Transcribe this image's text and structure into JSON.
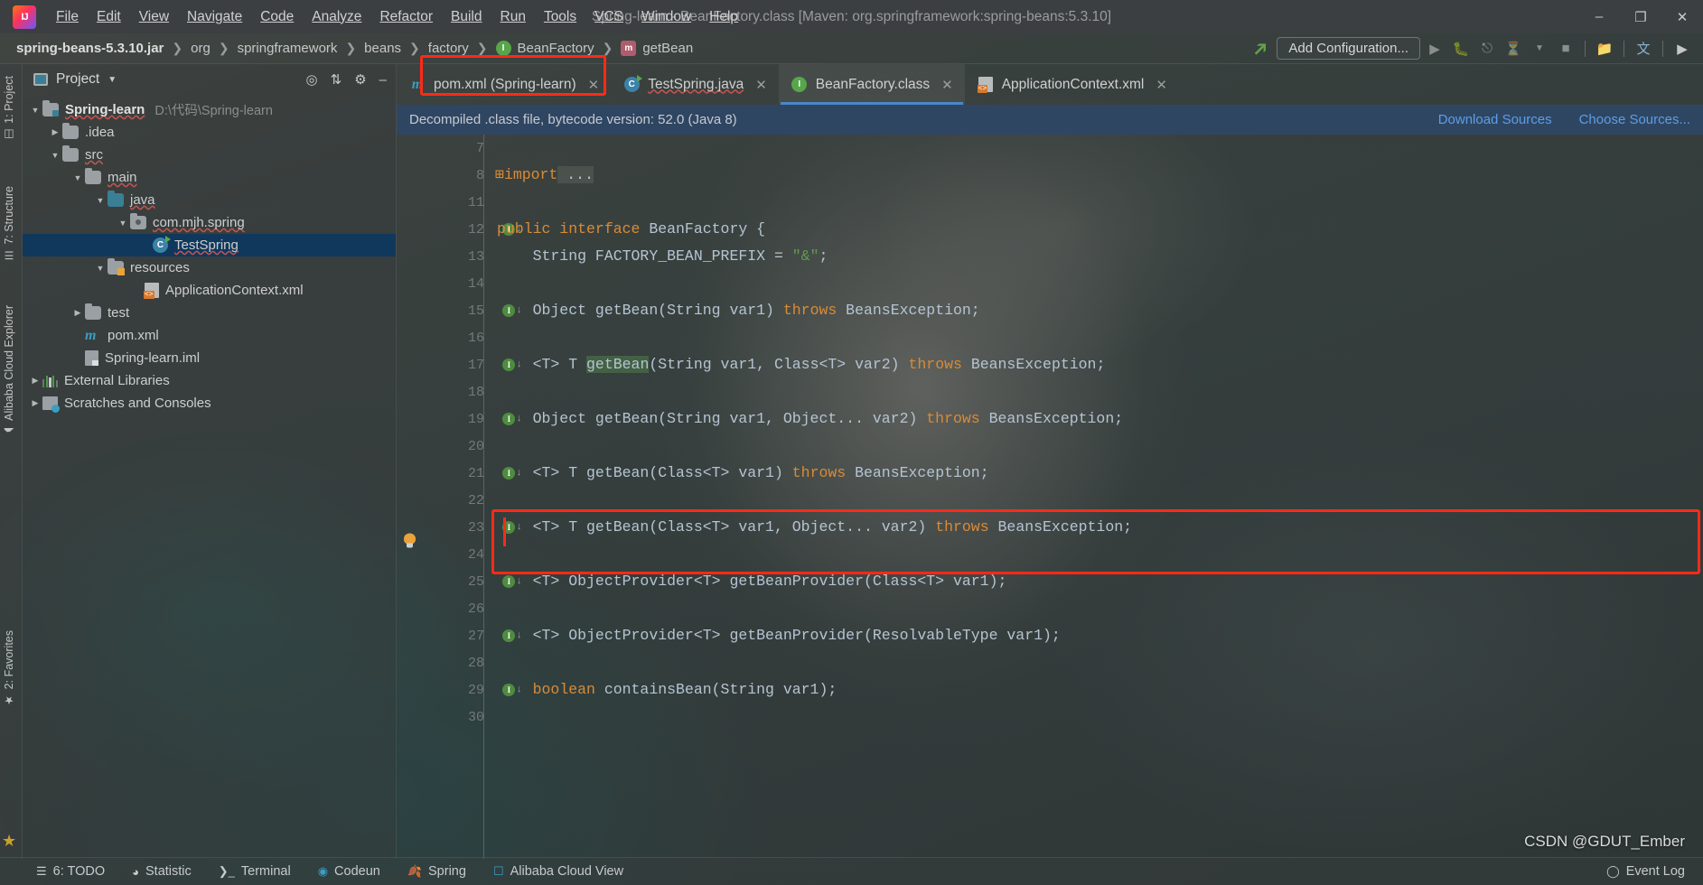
{
  "window": {
    "title": "Spring-learn - BeanFactory.class [Maven: org.springframework:spring-beans:5.3.10]",
    "logo": "intellij-idea-logo",
    "minimize": "–",
    "maximize": "❐",
    "close": "✕"
  },
  "menu": [
    {
      "label": "File"
    },
    {
      "label": "Edit"
    },
    {
      "label": "View"
    },
    {
      "label": "Navigate"
    },
    {
      "label": "Code"
    },
    {
      "label": "Analyze"
    },
    {
      "label": "Refactor"
    },
    {
      "label": "Build"
    },
    {
      "label": "Run"
    },
    {
      "label": "Tools"
    },
    {
      "label": "VCS"
    },
    {
      "label": "Window"
    },
    {
      "label": "Help"
    }
  ],
  "breadcrumb": [
    {
      "label": "spring-beans-5.3.10.jar",
      "icon": "",
      "bold": true
    },
    {
      "label": "org",
      "icon": ""
    },
    {
      "label": "springframework",
      "icon": ""
    },
    {
      "label": "beans",
      "icon": ""
    },
    {
      "label": "factory",
      "icon": ""
    },
    {
      "label": "BeanFactory",
      "icon": "interface-icon"
    },
    {
      "label": "getBean",
      "icon": "method-icon"
    }
  ],
  "toolbar": {
    "add_configuration": "Add Configuration...",
    "run_icon": "run-icon",
    "debug_icon": "debug-icon",
    "coverage_icon": "coverage-icon",
    "profile_icon": "profile-icon",
    "dropdown_icon": "chevron-down-icon",
    "stop_icon": "stop-icon",
    "project_structure_icon": "project-structure-icon",
    "translate_icon": "translate-icon",
    "console_icon": "console-icon"
  },
  "left_strip": [
    {
      "label": "1: Project",
      "icon": "project-icon"
    },
    {
      "label": "7: Structure",
      "icon": "structure-icon"
    },
    {
      "label": "Alibaba Cloud Explorer",
      "icon": "cloud-icon"
    },
    {
      "label": "2: Favorites",
      "icon": "star-icon"
    }
  ],
  "project_panel": {
    "title": "Project",
    "caret": "▼",
    "locate_icon": "locate-target-icon",
    "collapse_icon": "collapse-all-icon",
    "settings_icon": "gear-icon",
    "hide_icon": "hide-icon",
    "tree": [
      {
        "label": "Spring-learn",
        "path": "D:\\代码\\Spring-learn",
        "indent": 0,
        "arrow": "▼",
        "icon": "module-folder-icon",
        "bold": true,
        "selected": false
      },
      {
        "label": ".idea",
        "path": "",
        "indent": 1,
        "arrow": "▶",
        "icon": "folder-icon",
        "bold": false,
        "selected": false
      },
      {
        "label": "src",
        "path": "",
        "indent": 1,
        "arrow": "▼",
        "icon": "folder-icon",
        "bold": false,
        "selected": false
      },
      {
        "label": "main",
        "path": "",
        "indent": 2,
        "arrow": "▼",
        "icon": "folder-icon",
        "bold": false,
        "selected": false
      },
      {
        "label": "java",
        "path": "",
        "indent": 3,
        "arrow": "▼",
        "icon": "source-folder-icon",
        "bold": false,
        "selected": false
      },
      {
        "label": "com.mjh.spring",
        "path": "",
        "indent": 4,
        "arrow": "▼",
        "icon": "package-icon",
        "bold": false,
        "selected": false
      },
      {
        "label": "TestSpring",
        "path": "",
        "indent": 5,
        "arrow": "",
        "icon": "java-class-icon",
        "bold": false,
        "selected": true
      },
      {
        "label": "resources",
        "path": "",
        "indent": 3,
        "arrow": "▼",
        "icon": "resources-folder-icon",
        "bold": false,
        "selected": false
      },
      {
        "label": "ApplicationContext.xml",
        "path": "",
        "indent": 4,
        "arrow": "",
        "icon": "xml-file-icon",
        "bold": false,
        "selected": false
      },
      {
        "label": "test",
        "path": "",
        "indent": 2,
        "arrow": "▶",
        "icon": "folder-icon",
        "bold": false,
        "selected": false
      },
      {
        "label": "pom.xml",
        "path": "",
        "indent": 2,
        "arrow": "",
        "icon": "maven-icon",
        "bold": false,
        "selected": false
      },
      {
        "label": "Spring-learn.iml",
        "path": "",
        "indent": 2,
        "arrow": "",
        "icon": "iml-file-icon",
        "bold": false,
        "selected": false
      },
      {
        "label": "External Libraries",
        "path": "",
        "indent": 0,
        "arrow": "▶",
        "icon": "libraries-icon",
        "bold": false,
        "selected": false
      },
      {
        "label": "Scratches and Consoles",
        "path": "",
        "indent": 0,
        "arrow": "▶",
        "icon": "scratches-icon",
        "bold": false,
        "selected": false
      }
    ]
  },
  "editor": {
    "tabs": [
      {
        "label": "pom.xml (Spring-learn)",
        "icon": "maven-icon",
        "active": false,
        "close": "✕"
      },
      {
        "label": "TestSpring.java",
        "icon": "java-class-icon",
        "active": false,
        "close": "✕"
      },
      {
        "label": "BeanFactory.class",
        "icon": "interface-icon",
        "active": true,
        "close": "✕"
      },
      {
        "label": "ApplicationContext.xml",
        "icon": "xml-file-icon",
        "active": false,
        "close": "✕"
      }
    ],
    "notification": {
      "message": "Decompiled .class file, bytecode version: 52.0 (Java 8)",
      "download_sources": "Download Sources",
      "choose_sources": "Choose Sources..."
    },
    "lines": [
      {
        "num": "7",
        "text": "",
        "marker": false,
        "bulb": false,
        "fold": false
      },
      {
        "num": "8",
        "text": "import ...",
        "marker": false,
        "bulb": false,
        "fold": true
      },
      {
        "num": "11",
        "text": "",
        "marker": false,
        "bulb": false,
        "fold": false
      },
      {
        "num": "12",
        "text": "public interface BeanFactory {",
        "marker": true,
        "bulb": false,
        "fold": false
      },
      {
        "num": "13",
        "text": "    String FACTORY_BEAN_PREFIX = \"&\";",
        "marker": false,
        "bulb": false,
        "fold": false
      },
      {
        "num": "14",
        "text": "",
        "marker": false,
        "bulb": false,
        "fold": false
      },
      {
        "num": "15",
        "text": "    Object getBean(String var1) throws BeansException;",
        "marker": true,
        "bulb": false,
        "fold": false
      },
      {
        "num": "16",
        "text": "",
        "marker": false,
        "bulb": false,
        "fold": false
      },
      {
        "num": "17",
        "text": "    <T> T getBean(String var1, Class<T> var2) throws BeansException;",
        "marker": true,
        "bulb": true,
        "fold": false
      },
      {
        "num": "18",
        "text": "",
        "marker": false,
        "bulb": false,
        "fold": false
      },
      {
        "num": "19",
        "text": "    Object getBean(String var1, Object... var2) throws BeansException;",
        "marker": true,
        "bulb": false,
        "fold": false
      },
      {
        "num": "20",
        "text": "",
        "marker": false,
        "bulb": false,
        "fold": false
      },
      {
        "num": "21",
        "text": "    <T> T getBean(Class<T> var1) throws BeansException;",
        "marker": true,
        "bulb": false,
        "fold": false
      },
      {
        "num": "22",
        "text": "",
        "marker": false,
        "bulb": false,
        "fold": false
      },
      {
        "num": "23",
        "text": "    <T> T getBean(Class<T> var1, Object... var2) throws BeansException;",
        "marker": true,
        "bulb": false,
        "fold": false
      },
      {
        "num": "24",
        "text": "",
        "marker": false,
        "bulb": false,
        "fold": false
      },
      {
        "num": "25",
        "text": "    <T> ObjectProvider<T> getBeanProvider(Class<T> var1);",
        "marker": true,
        "bulb": false,
        "fold": false
      },
      {
        "num": "26",
        "text": "",
        "marker": false,
        "bulb": false,
        "fold": false
      },
      {
        "num": "27",
        "text": "    <T> ObjectProvider<T> getBeanProvider(ResolvableType var1);",
        "marker": true,
        "bulb": false,
        "fold": false
      },
      {
        "num": "28",
        "text": "",
        "marker": false,
        "bulb": false,
        "fold": false
      },
      {
        "num": "29",
        "text": "    boolean containsBean(String var1);",
        "marker": true,
        "bulb": false,
        "fold": false
      },
      {
        "num": "30",
        "text": "",
        "marker": false,
        "bulb": false,
        "fold": false
      }
    ]
  },
  "statusbar": [
    {
      "label": "6: TODO",
      "icon": "todo-icon"
    },
    {
      "label": "Statistic",
      "icon": "statistic-icon"
    },
    {
      "label": "Terminal",
      "icon": "terminal-icon"
    },
    {
      "label": "Codeun",
      "icon": "codeun-icon"
    },
    {
      "label": "Spring",
      "icon": "spring-leaf-icon"
    },
    {
      "label": "Alibaba Cloud View",
      "icon": "alibaba-cloud-icon"
    }
  ],
  "event_log": "Event Log",
  "watermark": "CSDN @GDUT_Ember",
  "colors": {
    "accent_red": "#ff2a17",
    "tab_underline": "#4a88c7",
    "notification_bg": "#2f4662",
    "link": "#5b9ee8",
    "selection": "#10385c",
    "keyword": "#d98b38",
    "string": "#5f9c4b"
  }
}
